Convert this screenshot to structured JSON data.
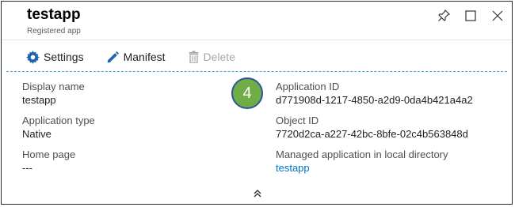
{
  "header": {
    "title": "testapp",
    "subtitle": "Registered app"
  },
  "toolbar": {
    "settings_label": "Settings",
    "manifest_label": "Manifest",
    "delete_label": "Delete"
  },
  "essentials": {
    "left": [
      {
        "label": "Display name",
        "value": "testapp"
      },
      {
        "label": "Application type",
        "value": "Native"
      },
      {
        "label": "Home page",
        "value": "---"
      }
    ],
    "right": [
      {
        "label": "Application ID",
        "value": "d771908d-1217-4850-a2d9-0da4b421a4a2"
      },
      {
        "label": "Object ID",
        "value": "7720d2ca-a227-42bc-8bfe-02c4b563848d"
      },
      {
        "label": "Managed application in local directory",
        "value": "testapp"
      }
    ]
  },
  "callout": {
    "number": "4",
    "color": "#70ad47"
  },
  "colors": {
    "accent": "#0072c6",
    "dashed_divider": "#4aa3df"
  }
}
